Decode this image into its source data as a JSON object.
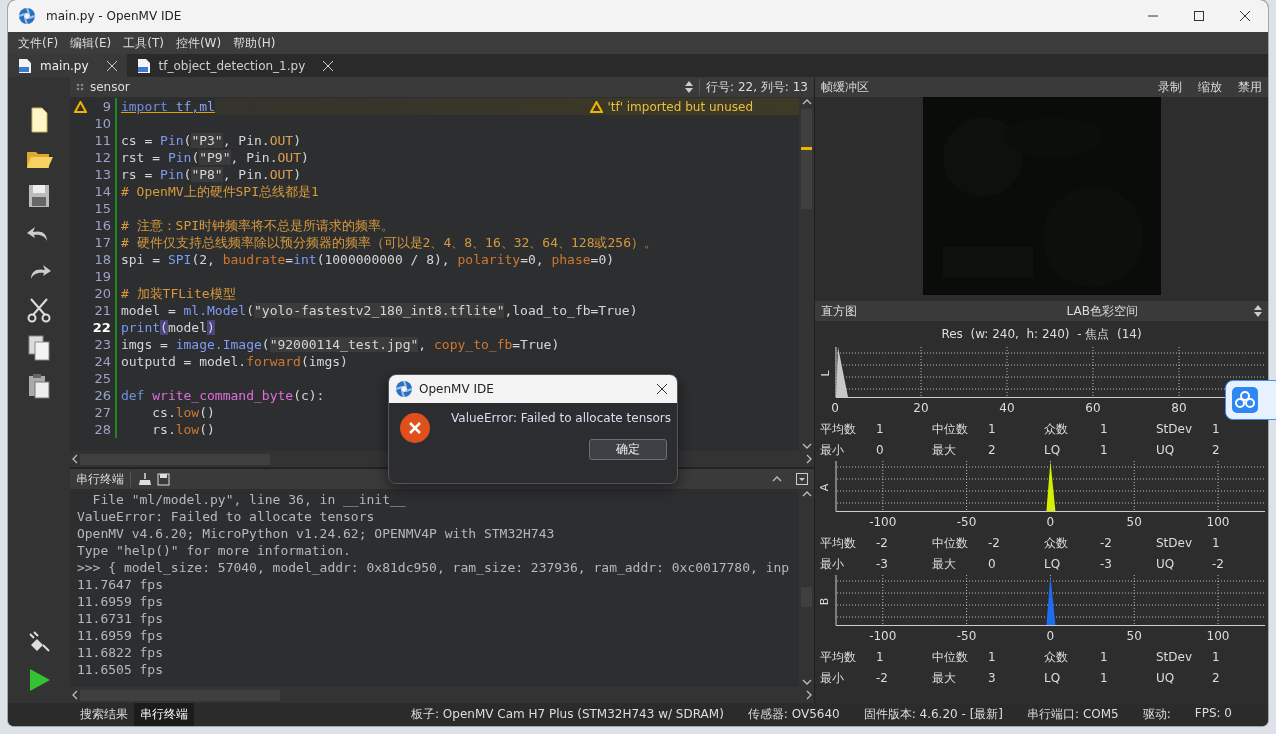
{
  "window": {
    "title": "main.py - OpenMV IDE"
  },
  "menu": [
    "文件(F)",
    "编辑(E)",
    "工具(T)",
    "控件(W)",
    "帮助(H)"
  ],
  "tabs": [
    {
      "label": "main.py",
      "selected": true
    },
    {
      "label": "tf_object_detection_1.py",
      "selected": false
    }
  ],
  "editor": {
    "breadcrumb": "sensor",
    "position": "行号: 22, 列号: 13",
    "lines": [
      {
        "number": "9",
        "current": false,
        "warning": "'tf' imported but unused",
        "tokens": [
          {
            "text": "import",
            "kind": "keyword"
          },
          {
            "text": " tf,ml",
            "kind": "module"
          }
        ]
      },
      {
        "number": "10",
        "current": false
      },
      {
        "number": "11",
        "current": false,
        "tokens": [
          {
            "text": "cs = ",
            "kind": "plain"
          },
          {
            "text": "Pin",
            "kind": "builtin"
          },
          {
            "text": "(",
            "kind": "plain"
          },
          {
            "text": "\"P3\"",
            "kind": "string"
          },
          {
            "text": ", Pin.",
            "kind": "plain"
          },
          {
            "text": "OUT",
            "kind": "attr"
          },
          {
            "text": ")",
            "kind": "plain"
          }
        ]
      },
      {
        "number": "12",
        "current": false,
        "tokens": [
          {
            "text": "rst = ",
            "kind": "plain"
          },
          {
            "text": "Pin",
            "kind": "builtin"
          },
          {
            "text": "(",
            "kind": "plain"
          },
          {
            "text": "\"P9\"",
            "kind": "string"
          },
          {
            "text": ", Pin.",
            "kind": "plain"
          },
          {
            "text": "OUT",
            "kind": "attr"
          },
          {
            "text": ")",
            "kind": "plain"
          }
        ]
      },
      {
        "number": "13",
        "current": false,
        "tokens": [
          {
            "text": "rs = ",
            "kind": "plain"
          },
          {
            "text": "Pin",
            "kind": "builtin"
          },
          {
            "text": "(",
            "kind": "plain"
          },
          {
            "text": "\"P8\"",
            "kind": "string"
          },
          {
            "text": ", Pin.",
            "kind": "plain"
          },
          {
            "text": "OUT",
            "kind": "attr"
          },
          {
            "text": ")",
            "kind": "plain"
          }
        ]
      },
      {
        "number": "14",
        "current": false,
        "tokens": [
          {
            "text": "# OpenMV上的硬件SPI总线都是1",
            "kind": "comment"
          }
        ]
      },
      {
        "number": "15",
        "current": false
      },
      {
        "number": "16",
        "current": false,
        "tokens": [
          {
            "text": "# 注意：SPI时钟频率将不总是所请求的频率。",
            "kind": "comment"
          }
        ]
      },
      {
        "number": "17",
        "current": false,
        "tokens": [
          {
            "text": "# 硬件仅支持总线频率除以预分频器的频率（可以是2、4、8、16、32、64、128或256）。",
            "kind": "comment"
          }
        ]
      },
      {
        "number": "18",
        "current": false,
        "tokens": [
          {
            "text": "spi = ",
            "kind": "plain"
          },
          {
            "text": "SPI",
            "kind": "builtin"
          },
          {
            "text": "(2, ",
            "kind": "plain"
          },
          {
            "text": "baudrate",
            "kind": "param"
          },
          {
            "text": "=",
            "kind": "plain"
          },
          {
            "text": "int",
            "kind": "builtin"
          },
          {
            "text": "(1000000000 / 8), ",
            "kind": "plain"
          },
          {
            "text": "polarity",
            "kind": "param"
          },
          {
            "text": "=0, ",
            "kind": "plain"
          },
          {
            "text": "phase",
            "kind": "param"
          },
          {
            "text": "=0)",
            "kind": "plain"
          }
        ]
      },
      {
        "number": "19",
        "current": false
      },
      {
        "number": "20",
        "current": false,
        "tokens": [
          {
            "text": "# 加装TFLite模型",
            "kind": "comment"
          }
        ]
      },
      {
        "number": "21",
        "current": false,
        "tokens": [
          {
            "text": "model = ",
            "kind": "plain"
          },
          {
            "text": "ml.Model",
            "kind": "builtin"
          },
          {
            "text": "(",
            "kind": "plain"
          },
          {
            "text": "\"yolo-fastestv2_180_int8.tflite\"",
            "kind": "string"
          },
          {
            "text": ",load_to_fb=True)",
            "kind": "plain"
          }
        ]
      },
      {
        "number": "22",
        "current": true,
        "tokens": [
          {
            "text": "print",
            "kind": "builtin"
          },
          {
            "text": "(",
            "kind": "match"
          },
          {
            "text": "model",
            "kind": "plain"
          },
          {
            "text": ")",
            "kind": "match"
          }
        ]
      },
      {
        "number": "23",
        "current": false,
        "tokens": [
          {
            "text": "imgs = ",
            "kind": "plain"
          },
          {
            "text": "image.Image",
            "kind": "builtin"
          },
          {
            "text": "(",
            "kind": "plain"
          },
          {
            "text": "\"92000114_test.jpg\"",
            "kind": "string"
          },
          {
            "text": ", ",
            "kind": "plain"
          },
          {
            "text": "copy_to_fb",
            "kind": "param"
          },
          {
            "text": "=True)",
            "kind": "plain"
          }
        ]
      },
      {
        "number": "24",
        "current": false,
        "tokens": [
          {
            "text": "outputd = model.",
            "kind": "plain"
          },
          {
            "text": "forward",
            "kind": "method"
          },
          {
            "text": "(imgs)",
            "kind": "plain"
          }
        ]
      },
      {
        "number": "25",
        "current": false
      },
      {
        "number": "26",
        "current": false,
        "tokens": [
          {
            "text": "def",
            "kind": "keyword"
          },
          {
            "text": " write_command_byte",
            "kind": "funcdef"
          },
          {
            "text": "(c):",
            "kind": "plain"
          }
        ]
      },
      {
        "number": "27",
        "current": false,
        "tokens": [
          {
            "text": "    cs.",
            "kind": "plain"
          },
          {
            "text": "low",
            "kind": "method"
          },
          {
            "text": "()",
            "kind": "plain"
          }
        ]
      },
      {
        "number": "28",
        "current": false,
        "tokens": [
          {
            "text": "    rs.",
            "kind": "plain"
          },
          {
            "text": "low",
            "kind": "method"
          },
          {
            "text": "()",
            "kind": "plain"
          }
        ]
      }
    ]
  },
  "terminal": {
    "title": "串行终端",
    "lines": [
      "  File \"ml/model.py\", line 36, in __init__",
      "ValueError: Failed to allocate tensors",
      "OpenMV v4.6.20; MicroPython v1.24.62; OPENMV4P with STM32H743",
      "Type \"help()\" for more information.",
      ">>> { model_size: 57040, model_addr: 0x81dc950, ram_size: 237936, ram_addr: 0xc0017780, inp",
      "11.7647 fps",
      "11.6959 fps",
      "11.6731 fps",
      "11.6959 fps",
      "11.6822 fps",
      "11.6505 fps"
    ]
  },
  "frame_buffer": {
    "title": "帧缓冲区",
    "actions": [
      "录制",
      "缩放",
      "禁用"
    ]
  },
  "histogram": {
    "title": "直方图",
    "color_space": "LAB色彩空间",
    "resolution": "Res  (w: 240,  h: 240)  - 焦点  (14)",
    "channels": [
      {
        "label": "L",
        "kind": "lightness",
        "color": "#c8c8c8",
        "ticks": [
          "0",
          "20",
          "40",
          "60",
          "80"
        ],
        "stats": [
          [
            {
              "label": "平均数",
              "value": "1"
            },
            {
              "label": "中位数",
              "value": "1"
            },
            {
              "label": "众数",
              "value": "1"
            },
            {
              "label": "StDev",
              "value": "1"
            }
          ],
          [
            {
              "label": "最小",
              "value": "0"
            },
            {
              "label": "最大",
              "value": "2"
            },
            {
              "label": "LQ",
              "value": "1"
            },
            {
              "label": "UQ",
              "value": "2"
            }
          ]
        ]
      },
      {
        "label": "A",
        "kind": "signed",
        "color": "#d4f000",
        "ticks": [
          "-100",
          "-50",
          "0",
          "50",
          "100"
        ],
        "stats": [
          [
            {
              "label": "平均数",
              "value": "-2"
            },
            {
              "label": "中位数",
              "value": "-2"
            },
            {
              "label": "众数",
              "value": "-2"
            },
            {
              "label": "StDev",
              "value": "1"
            }
          ],
          [
            {
              "label": "最小",
              "value": "-3"
            },
            {
              "label": "最大",
              "value": "0"
            },
            {
              "label": "LQ",
              "value": "-3"
            },
            {
              "label": "UQ",
              "value": "-2"
            }
          ]
        ]
      },
      {
        "label": "B",
        "kind": "signed",
        "color": "#1e6cf0",
        "ticks": [
          "-100",
          "-50",
          "0",
          "50",
          "100"
        ],
        "stats": [
          [
            {
              "label": "平均数",
              "value": "1"
            },
            {
              "label": "中位数",
              "value": "1"
            },
            {
              "label": "众数",
              "value": "1"
            },
            {
              "label": "StDev",
              "value": "1"
            }
          ],
          [
            {
              "label": "最小",
              "value": "-2"
            },
            {
              "label": "最大",
              "value": "3"
            },
            {
              "label": "LQ",
              "value": "1"
            },
            {
              "label": "UQ",
              "value": "2"
            }
          ]
        ]
      }
    ]
  },
  "dialog": {
    "title": "OpenMV IDE",
    "message": "ValueError: Failed to allocate tensors",
    "button": "确定"
  },
  "status_bar": {
    "panes": [
      {
        "label": "搜索结果",
        "selected": false
      },
      {
        "label": "串行终端",
        "selected": true
      }
    ],
    "info": [
      "板子: OpenMV Cam H7 Plus (STM32H743 w/ SDRAM)",
      "传感器: OV5640",
      "固件版本: 4.6.20 - [最新]",
      "串行端口: COM5",
      "驱动:",
      "FPS: 0"
    ]
  }
}
